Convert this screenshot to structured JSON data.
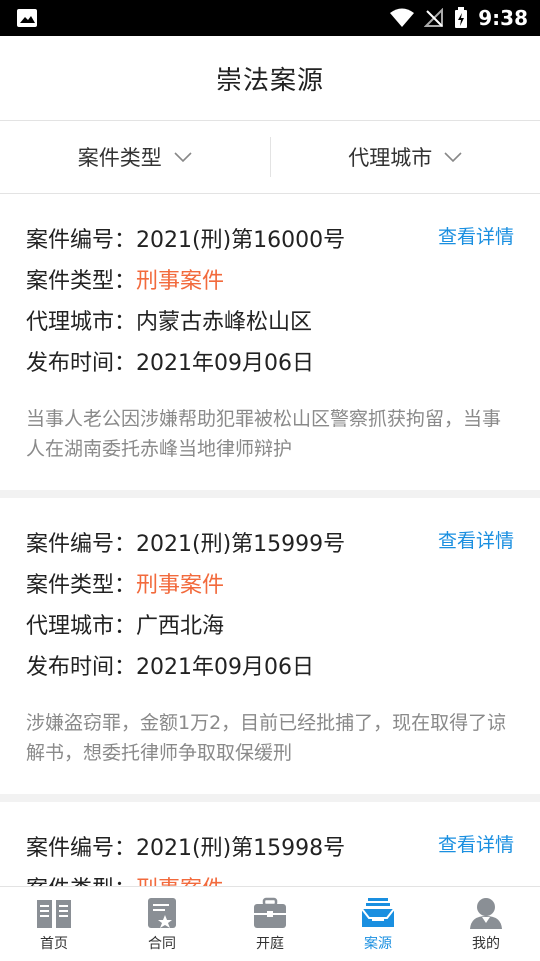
{
  "status_bar": {
    "time": "9:38"
  },
  "header": {
    "title": "崇法案源"
  },
  "filters": [
    {
      "label": "案件类型"
    },
    {
      "label": "代理城市"
    }
  ],
  "cards": [
    {
      "number_label": "案件编号：",
      "number": "2021(刑)第16000号",
      "type_label": "案件类型：",
      "type": "刑事案件",
      "city_label": "代理城市：",
      "city": "内蒙古赤峰松山区",
      "date_label": "发布时间：",
      "date": "2021年09月06日",
      "detail": "查看详情",
      "desc": "当事人老公因涉嫌帮助犯罪被松山区警察抓获拘留，当事人在湖南委托赤峰当地律师辩护"
    },
    {
      "number_label": "案件编号：",
      "number": "2021(刑)第15999号",
      "type_label": "案件类型：",
      "type": "刑事案件",
      "city_label": "代理城市：",
      "city": "广西北海",
      "date_label": "发布时间：",
      "date": "2021年09月06日",
      "detail": "查看详情",
      "desc": "涉嫌盗窃罪，金额1万2，目前已经批捕了，现在取得了谅解书，想委托律师争取取保缓刑"
    },
    {
      "number_label": "案件编号：",
      "number": "2021(刑)第15998号",
      "type_label": "案件类型：",
      "type": "刑事案件",
      "detail": "查看详情"
    }
  ],
  "nav": [
    {
      "label": "首页",
      "icon": "book-icon",
      "active": false
    },
    {
      "label": "合同",
      "icon": "contract-icon",
      "active": false
    },
    {
      "label": "开庭",
      "icon": "briefcase-icon",
      "active": false
    },
    {
      "label": "案源",
      "icon": "inbox-icon",
      "active": true
    },
    {
      "label": "我的",
      "icon": "user-icon",
      "active": false
    }
  ],
  "colors": {
    "accent": "#1a8fe0",
    "highlight": "#f26a3c",
    "icon_gray": "#8a8f95"
  }
}
